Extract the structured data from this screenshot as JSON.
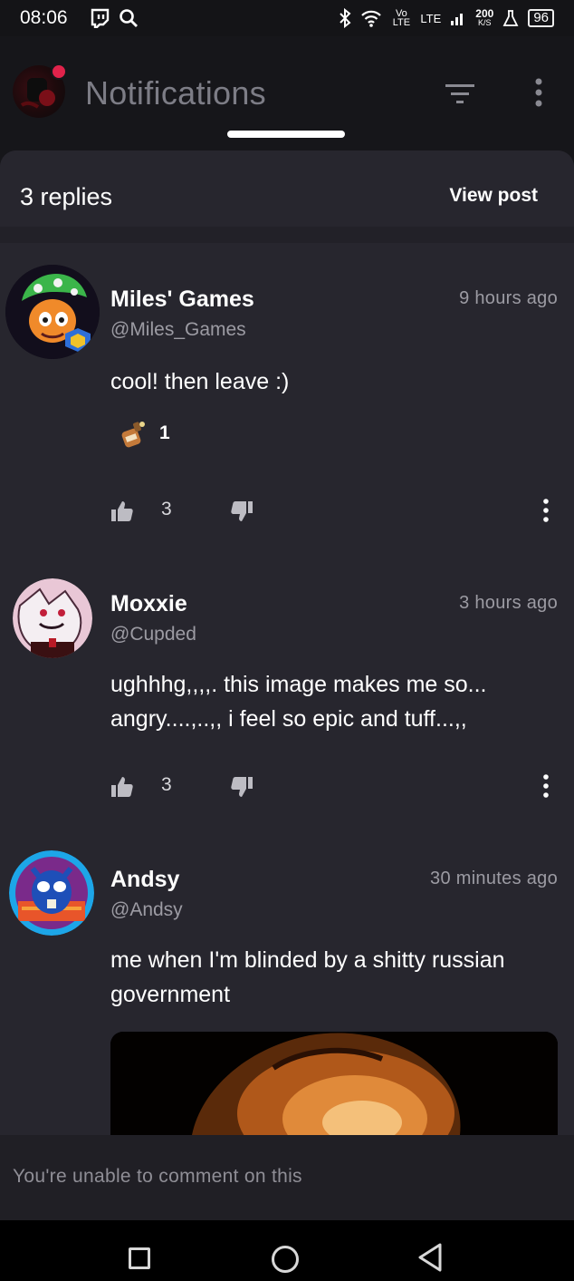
{
  "status_bar": {
    "time": "08:06",
    "network_speed": "200",
    "network_speed_unit": "K/S",
    "network_type": "LTE",
    "volte": "Vo LTE",
    "battery": "96"
  },
  "header": {
    "title": "Notifications",
    "filter_icon": "filter-icon",
    "more_icon": "more-vert-icon"
  },
  "thread": {
    "replies_label": "3 replies",
    "view_post_label": "View post"
  },
  "comments": [
    {
      "name": "Miles' Games",
      "handle": "@Miles_Games",
      "time": "9 hours ago",
      "text": "cool! then leave :)",
      "reaction_count": "1",
      "likes": "3"
    },
    {
      "name": "Moxxie",
      "handle": "@Cupded",
      "time": "3 hours ago",
      "text": "ughhhg,,,,. this image makes me so... angry....,..,, i feel so epic and tuff...,,",
      "likes": "3"
    },
    {
      "name": "Andsy",
      "handle": "@Andsy",
      "time": "30 minutes ago",
      "text": "me when I'm blinded by a shitty russian government"
    }
  ],
  "comment_bar": {
    "text": "You're unable to comment on this"
  },
  "colors": {
    "background": "#16161a",
    "sheet": "#27262e",
    "muted_text": "#9c9ba3",
    "notification_dot": "#e0234b"
  }
}
